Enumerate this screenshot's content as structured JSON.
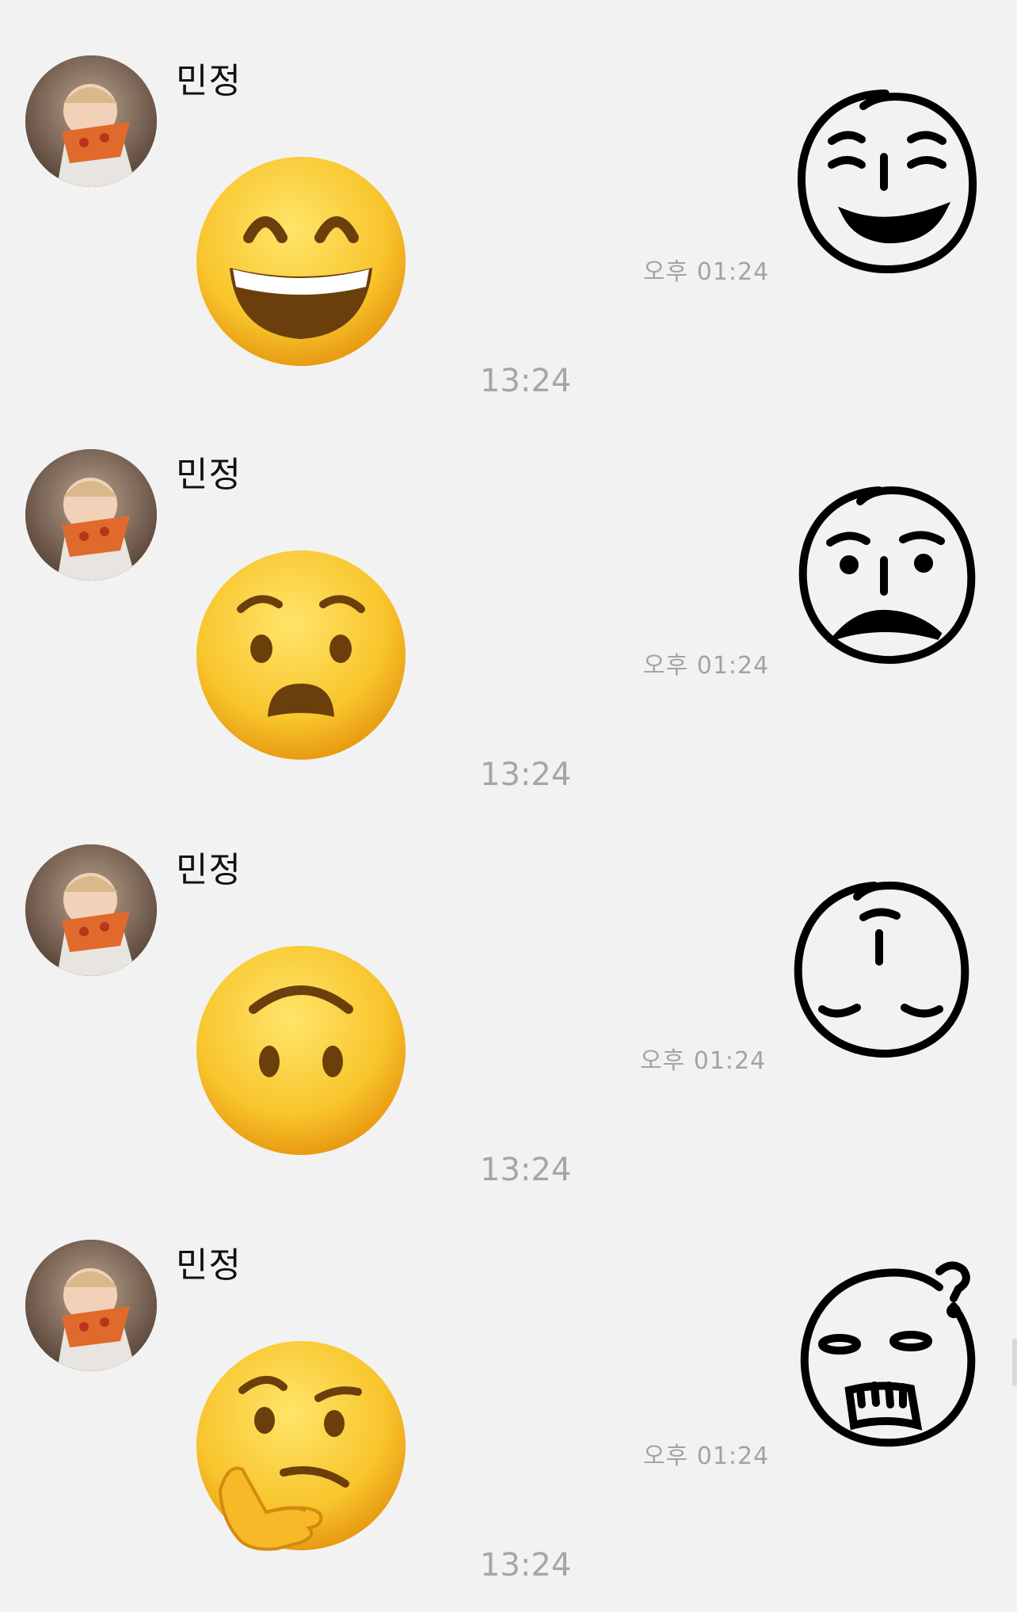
{
  "messages": [
    {
      "sender": "민정",
      "sent_time": "13:24",
      "reply_time": "오후 01:24",
      "emoji_icon": "grinning-smiling-eyes-emoji",
      "doodle_icon": "smiling-doodle-face"
    },
    {
      "sender": "민정",
      "sent_time": "13:24",
      "reply_time": "오후 01:24",
      "emoji_icon": "frowning-open-mouth-emoji",
      "doodle_icon": "frowning-doodle-face"
    },
    {
      "sender": "민정",
      "sent_time": "13:24",
      "reply_time": "오후 01:24",
      "emoji_icon": "upside-down-face-emoji",
      "doodle_icon": "upside-down-doodle-face"
    },
    {
      "sender": "민정",
      "sent_time": "13:24",
      "reply_time": "오후 01:24",
      "emoji_icon": "thinking-face-emoji",
      "doodle_icon": "confused-doodle-face"
    }
  ],
  "colors": {
    "background": "#f2f2f2",
    "timestamp": "#a6a6a6",
    "emoji_yellow": "#f6c12e"
  }
}
